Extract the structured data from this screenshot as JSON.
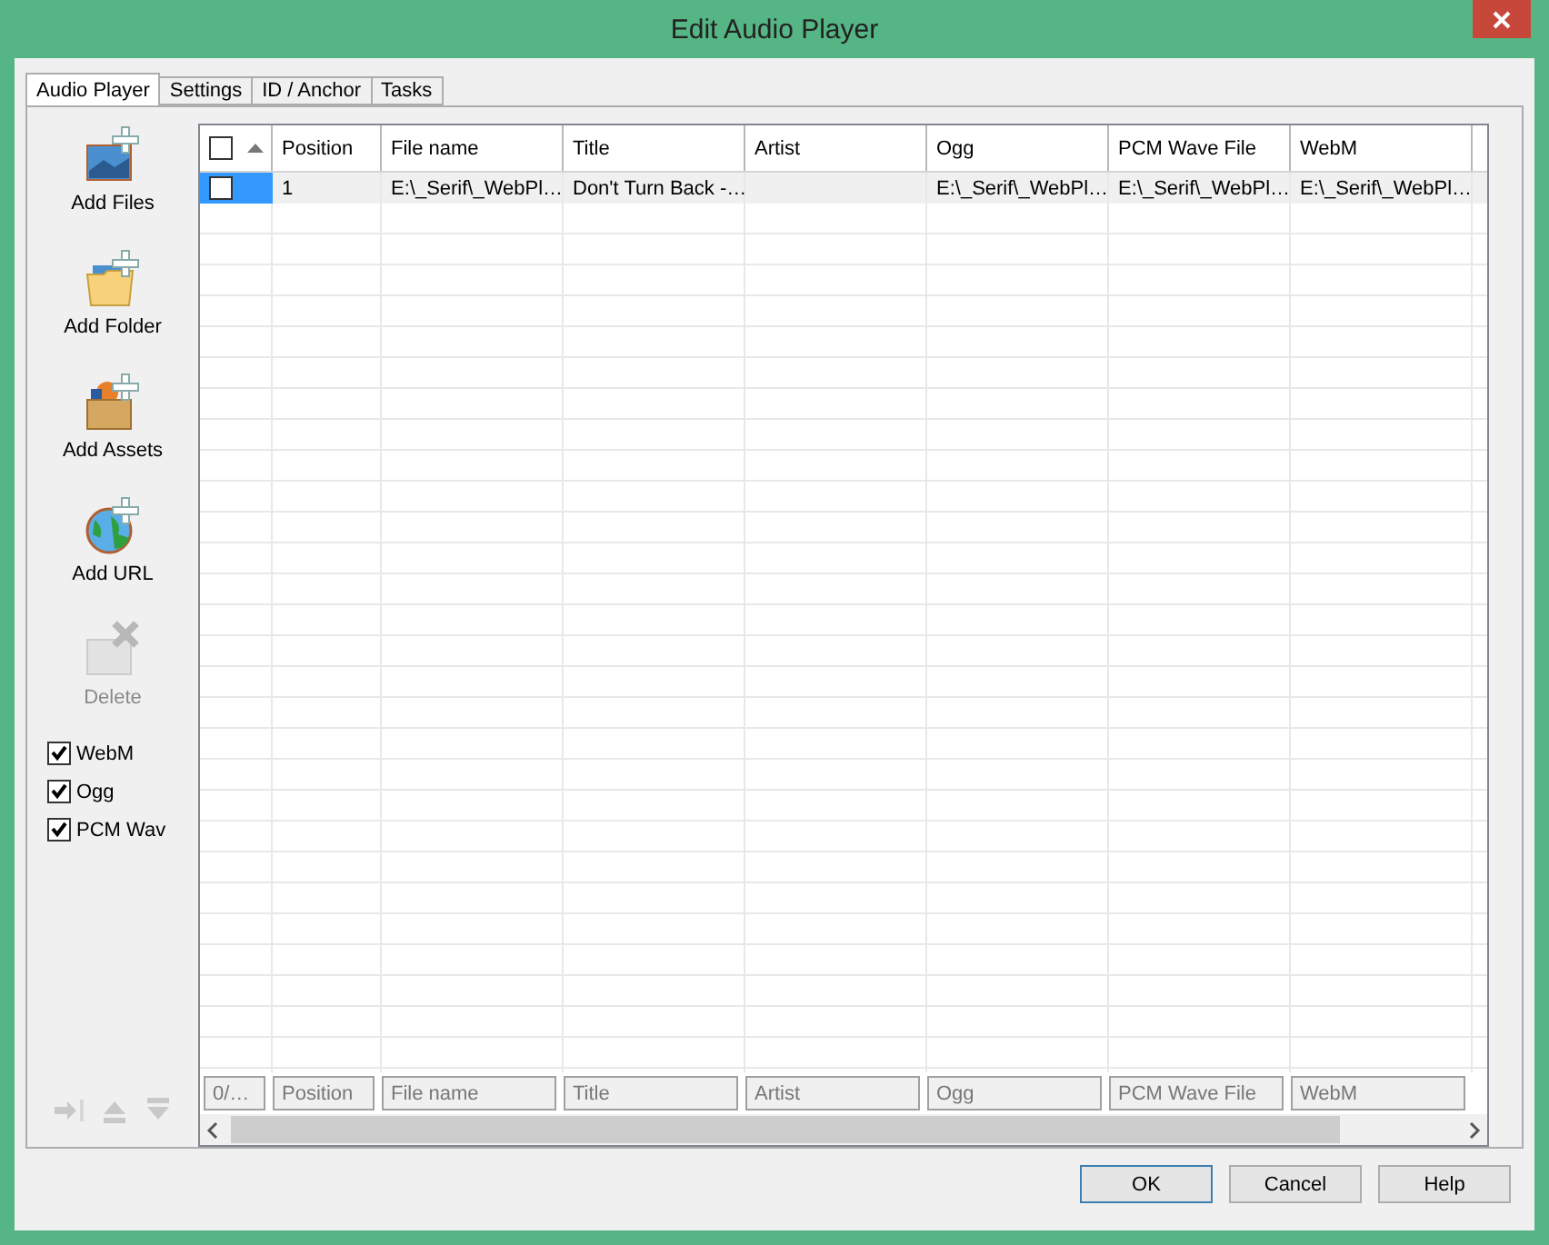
{
  "window": {
    "title": "Edit Audio Player"
  },
  "tabs": [
    {
      "label": "Audio Player",
      "selected": true
    },
    {
      "label": "Settings",
      "selected": false
    },
    {
      "label": "ID / Anchor",
      "selected": false
    },
    {
      "label": "Tasks",
      "selected": false
    }
  ],
  "sidebar": {
    "actions": [
      {
        "kind": "files",
        "label": "Add Files",
        "disabled": false
      },
      {
        "kind": "folder",
        "label": "Add Folder",
        "disabled": false
      },
      {
        "kind": "assets",
        "label": "Add Assets",
        "disabled": false
      },
      {
        "kind": "url",
        "label": "Add URL",
        "disabled": false
      },
      {
        "kind": "delete",
        "label": "Delete",
        "disabled": true
      }
    ],
    "formats": [
      {
        "label": "WebM",
        "checked": true
      },
      {
        "label": "Ogg",
        "checked": true
      },
      {
        "label": "PCM Wav",
        "checked": true
      }
    ]
  },
  "table": {
    "header_checked": false,
    "columns": [
      "Position",
      "File name",
      "Title",
      "Artist",
      "Ogg",
      "PCM Wave File",
      "WebM"
    ],
    "rows": [
      {
        "checked": false,
        "selected": true,
        "cells": [
          "1",
          "E:\\_Serif\\_WebPl…",
          "Don't Turn Back -…",
          "",
          "E:\\_Serif\\_WebPl…",
          "E:\\_Serif\\_WebPl…",
          "E:\\_Serif\\_WebPl…"
        ]
      }
    ],
    "filters": [
      {
        "placeholder": "0/…"
      },
      {
        "placeholder": "Position"
      },
      {
        "placeholder": "File name"
      },
      {
        "placeholder": "Title"
      },
      {
        "placeholder": "Artist"
      },
      {
        "placeholder": "Ogg"
      },
      {
        "placeholder": "PCM Wave File"
      },
      {
        "placeholder": "WebM"
      }
    ]
  },
  "buttons": [
    "OK",
    "Cancel",
    "Help"
  ]
}
